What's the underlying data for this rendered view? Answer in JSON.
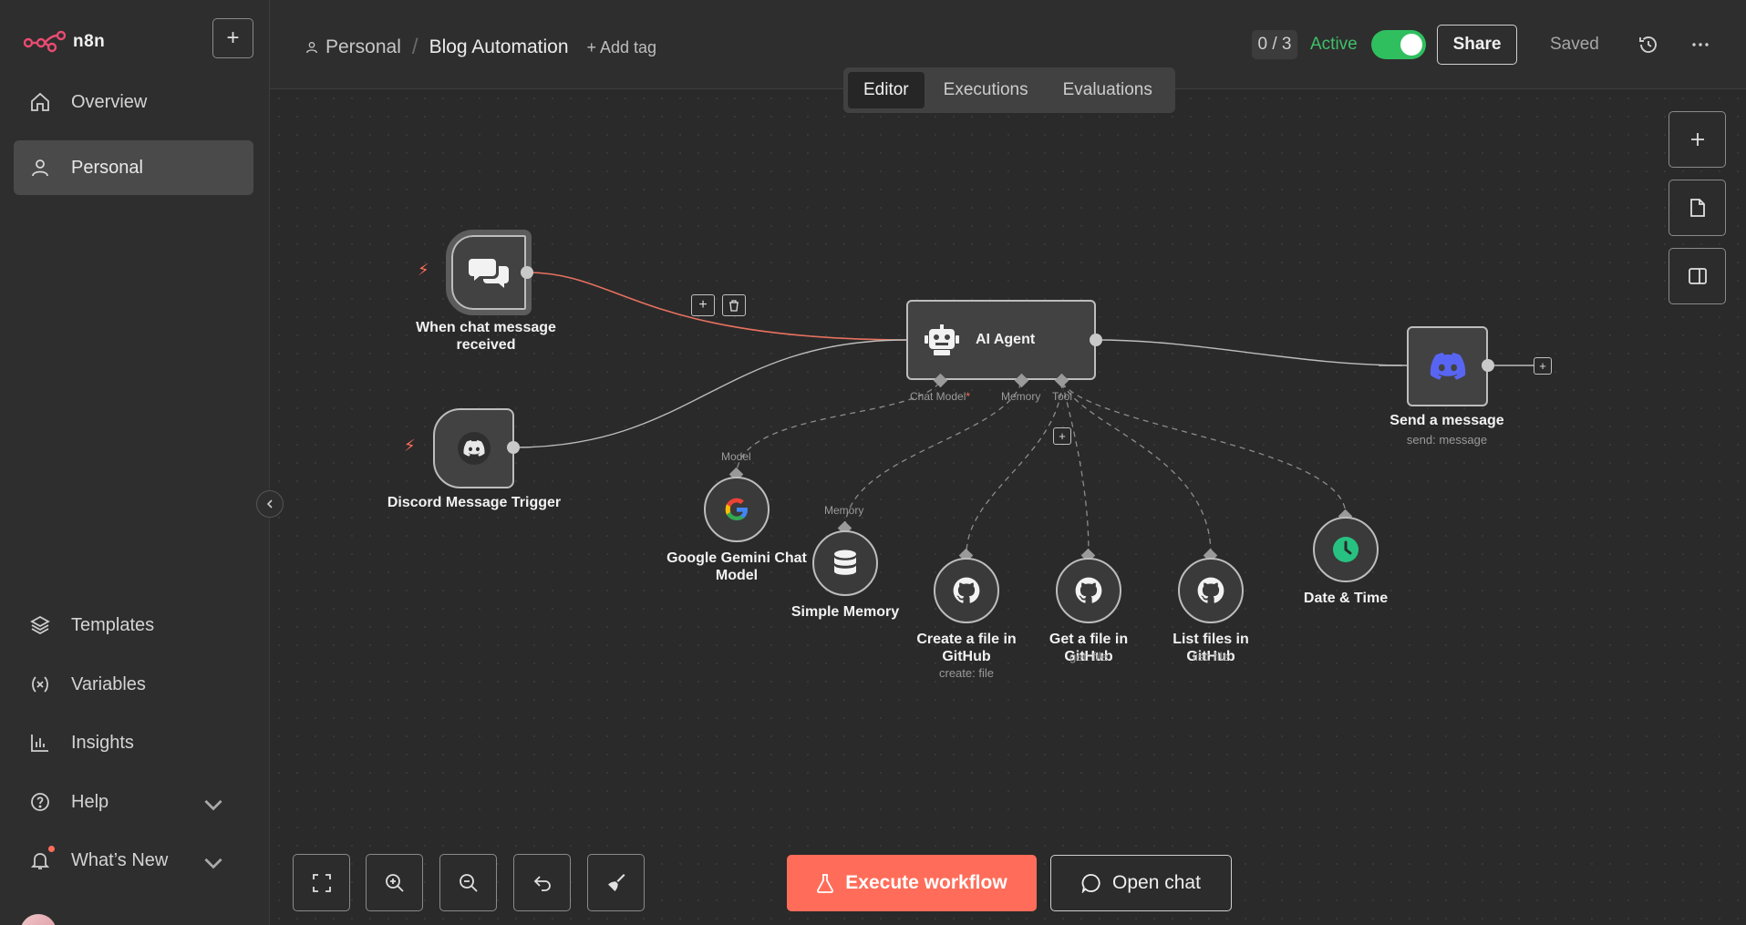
{
  "app": {
    "name": "n8n"
  },
  "sidebar": {
    "items_top": [
      {
        "label": "Overview",
        "icon": "home-icon"
      },
      {
        "label": "Personal",
        "icon": "user-icon",
        "active": true
      }
    ],
    "items_bottom": [
      {
        "label": "Templates",
        "icon": "templates-icon"
      },
      {
        "label": "Variables",
        "icon": "variables-icon"
      },
      {
        "label": "Insights",
        "icon": "insights-icon"
      },
      {
        "label": "Help",
        "icon": "help-icon"
      },
      {
        "label": "What’s New",
        "icon": "bell-icon"
      }
    ]
  },
  "header": {
    "breadcrumb_project": "Personal",
    "breadcrumb_separator": "/",
    "workflow_title": "Blog Automation",
    "add_tag": "+ Add tag",
    "counter": "0 / 3",
    "active_label": "Active",
    "share_label": "Share",
    "saved_label": "Saved"
  },
  "tabs": [
    "Editor",
    "Executions",
    "Evaluations"
  ],
  "nodes": {
    "chat_trigger": {
      "label_line1": "When chat message",
      "label_line2": "received"
    },
    "discord_trigger": {
      "label": "Discord Message Trigger"
    },
    "ai_agent": {
      "label": "AI Agent",
      "port_chat_model": "Chat Model",
      "port_required": "*",
      "port_memory": "Memory",
      "port_tool": "Tool"
    },
    "send_message": {
      "label": "Send a message",
      "sub": "send: message"
    },
    "gemini": {
      "port": "Model",
      "label_line1": "Google Gemini Chat",
      "label_line2": "Model"
    },
    "memory": {
      "port": "Memory",
      "label": "Simple Memory"
    },
    "gh_create": {
      "label_line1": "Create a file in",
      "label_line2": "GitHub",
      "sub": "create: file"
    },
    "gh_get": {
      "label": "Get a file in GitHub",
      "sub": "get: file"
    },
    "gh_list": {
      "label": "List files in GitHub",
      "sub": "list: file"
    },
    "datetime": {
      "label": "Date & Time"
    }
  },
  "footer": {
    "execute_label": "Execute workflow",
    "open_chat_label": "Open chat"
  },
  "colors": {
    "accent": "#ff6d5a",
    "active_green": "#2fbf5f",
    "discord": "#5865f2"
  }
}
